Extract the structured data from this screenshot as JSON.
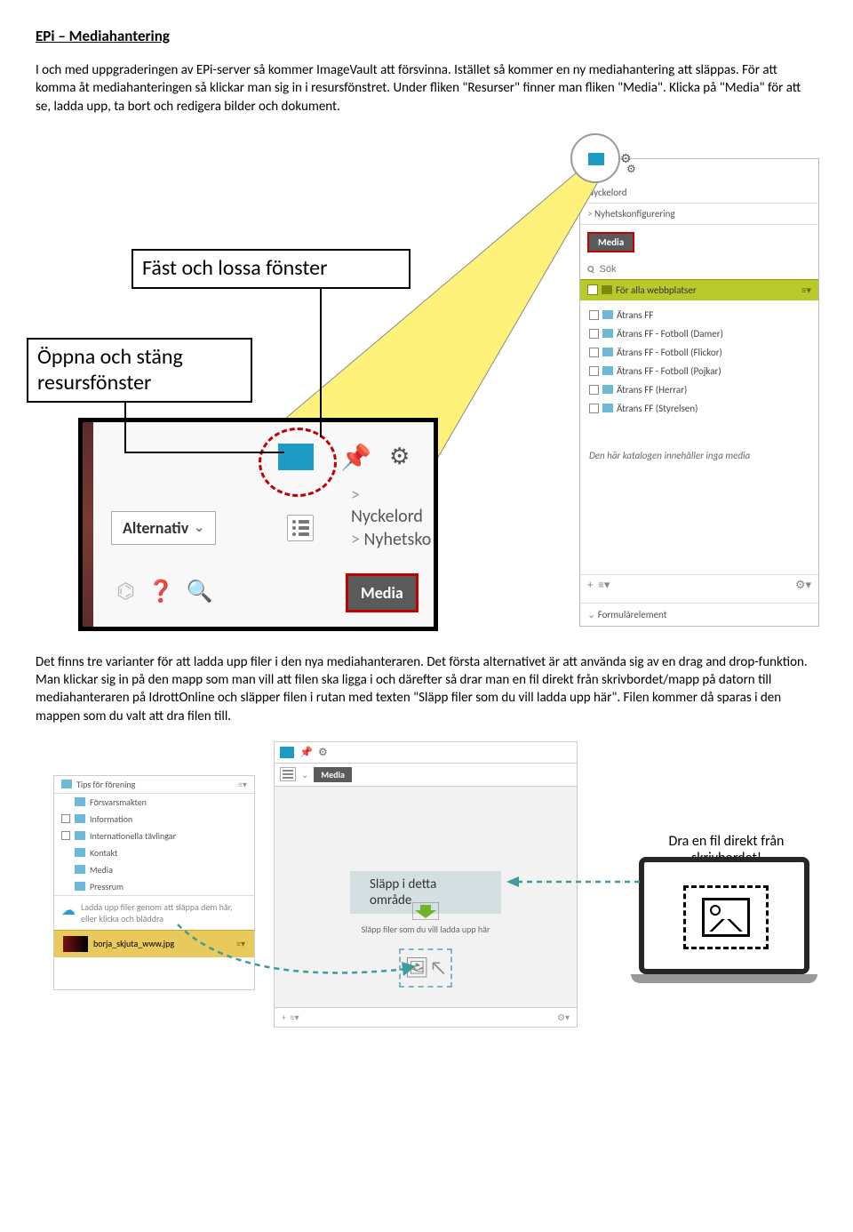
{
  "title": "EPi – Mediahantering",
  "para1": "I och med uppgraderingen av EPi-server så kommer ImageVault att försvinna. Istället så kommer en ny mediahantering att släppas. För att komma åt mediahanteringen så klickar man sig in i resursfönstret. Under fliken \"Resurser\" finner man fliken \"Media\". Klicka på \"Media\" för att se, ladda upp, ta bort och redigera bilder och dokument.",
  "para2": "Det finns tre varianter för att ladda upp filer i den nya mediahanteraren. Det första alternativet är att använda sig av en drag and drop-funktion. Man klickar sig in på den mapp som man vill att filen ska ligga i och därefter så drar man en fil direkt från skrivbordet/mapp på datorn till mediahanteraren på IdrottOnline och släpper filen i rutan med texten \"Släpp filer som du vill ladda upp här\". Filen kommer då sparas i den mappen som du valt att dra filen till.",
  "anno_pin": "Fäst och lossa fönster",
  "anno_open": "Öppna och stäng resursfönster",
  "zoom": {
    "alt_label": "Alternativ",
    "nyckel": "Nyckelord",
    "nyhetsk": "Nyhetsko",
    "media": "Media"
  },
  "rp": {
    "nyckelord": "Nyckelord",
    "nyhetskonf": "Nyhetskonfigurering",
    "media": "Media",
    "search_ph": "Sök",
    "olive": "För alla webbplatser",
    "tree": [
      "Ätrans FF",
      "Ätrans FF - Fotboll (Damer)",
      "Ätrans FF - Fotboll (Flickor)",
      "Ätrans FF - Fotboll (Pojkar)",
      "Ätrans FF (Herrar)",
      "Ätrans FF (Styrelsen)"
    ],
    "empty": "Den här katalogen innehåller inga media",
    "formular": "Formulärelement"
  },
  "fig2": {
    "left_top": "Tips för förening",
    "left_items": [
      "Försvarsmakten",
      "Information",
      "Internationella tävlingar",
      "Kontakt",
      "Media",
      "Pressrum"
    ],
    "upload_hint": "Ladda upp filer genom att släppa dem här, eller klicka och bläddra",
    "yellow_file": "borja_skjuta_www.jpg",
    "mid_media": "Media",
    "drop_label": "Släpp i detta område",
    "drop_sub": "Släpp filer som du vill ladda upp här",
    "right_caption": "Dra en fil direkt från skrivbordet!"
  }
}
